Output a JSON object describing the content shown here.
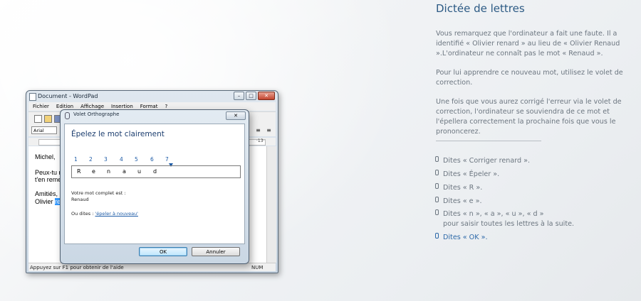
{
  "wordpad": {
    "title": "Document - WordPad",
    "controls": {
      "minimize": "–",
      "maximize": "□",
      "close": "✕"
    },
    "menu": [
      "Fichier",
      "Edition",
      "Affichage",
      "Insertion",
      "Format",
      "?"
    ],
    "font": "Arial",
    "ruler_right": "·13·",
    "doc_lines": [
      "Michel,",
      "Peux-tu r",
      "t'en reme",
      "Amitiés,"
    ],
    "doc_last_prefix": "Olivier ",
    "doc_last_selected": "re",
    "status": "Appuyez sur F1 pour obtenir de l'aide",
    "status_num": "NUM"
  },
  "spell_panel": {
    "title": "Volet Orthographe",
    "close_label": "✕",
    "heading": "Épelez le mot clairement",
    "numbers": [
      "1",
      "2",
      "3",
      "4",
      "5",
      "6",
      "7"
    ],
    "letters": [
      "R",
      "e",
      "n",
      "a",
      "u",
      "d"
    ],
    "complete_label": "Votre mot complet est :",
    "complete_word": "Renaud",
    "or_say_label": "Ou dites : ",
    "or_say_link": "'épeler à nouveau'",
    "ok": "OK",
    "cancel": "Annuler"
  },
  "lesson": {
    "title": "Dictée de lettres",
    "para1": "Vous remarquez que l'ordinateur a fait une faute. Il a identifié « Olivier renard » au lieu de « Olivier Renaud ».L'ordinateur ne connaît pas le mot « Renaud ».",
    "para2": "Pour lui apprendre ce nouveau mot, utilisez le volet de correction.",
    "para3": "Une fois que vous aurez corrigé l'erreur via le volet de correction, l'ordinateur se souviendra de ce mot et l'épellera correctement la prochaine fois que vous le prononcerez.",
    "steps": [
      "Dites « Corriger renard ».",
      "Dites « Épeler ».",
      "Dites « R ».",
      "Dites « e ».",
      "Dites « n », « a », « u », « d »"
    ],
    "step5_cont": "pour saisir toutes les lettres à la suite.",
    "step_active": "Dites « OK »."
  }
}
